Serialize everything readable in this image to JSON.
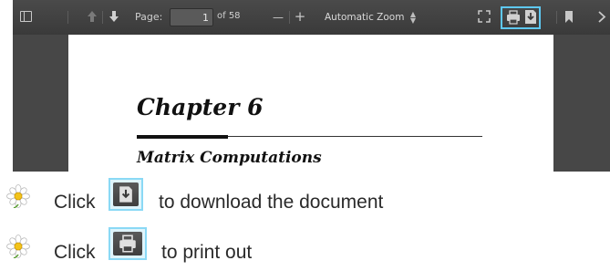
{
  "viewer": {
    "toolbar": {
      "page_label": "Page:",
      "page_number": "1",
      "page_of": "of 58",
      "zoom_out_symbol": "—",
      "zoom_in_symbol": "+",
      "zoom_value": "Automatic Zoom"
    },
    "document": {
      "chapter_title": "Chapter 6",
      "section_title": "Matrix Computations"
    }
  },
  "instructions": [
    {
      "click_word": "Click",
      "text": "to download the document",
      "icon": "download-icon"
    },
    {
      "click_word": "Click",
      "text": "to print out",
      "icon": "print-icon"
    }
  ],
  "colors": {
    "highlight": "#5ec8f2",
    "toolbar": "#444444"
  }
}
